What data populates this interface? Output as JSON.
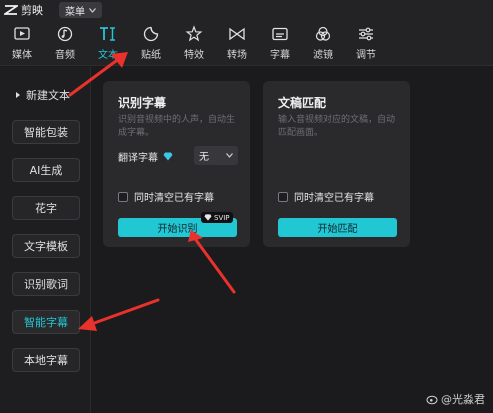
{
  "app": {
    "name": "剪映",
    "menu_label": "菜单"
  },
  "tools": [
    {
      "label": "媒体",
      "icon": "media-icon"
    },
    {
      "label": "音频",
      "icon": "audio-icon"
    },
    {
      "label": "文本",
      "icon": "text-icon",
      "active": true
    },
    {
      "label": "贴纸",
      "icon": "sticker-icon"
    },
    {
      "label": "特效",
      "icon": "effects-icon"
    },
    {
      "label": "转场",
      "icon": "transition-icon"
    },
    {
      "label": "字幕",
      "icon": "subtitle-icon"
    },
    {
      "label": "滤镜",
      "icon": "filter-icon"
    },
    {
      "label": "调节",
      "icon": "adjust-icon"
    }
  ],
  "sidebar": {
    "items": [
      {
        "label": "新建文本"
      },
      {
        "label": "智能包装"
      },
      {
        "label": "AI生成"
      },
      {
        "label": "花字"
      },
      {
        "label": "文字模板"
      },
      {
        "label": "识别歌词"
      },
      {
        "label": "智能字幕",
        "active": true
      },
      {
        "label": "本地字幕"
      }
    ]
  },
  "card_recognize": {
    "title": "识别字幕",
    "description": "识别音视频中的人声，自动生成字幕。",
    "translate_label": "翻译字幕",
    "translate_value": "无",
    "clear_label": "同时清空已有字幕",
    "button_label": "开始识别",
    "badge": "SVIP"
  },
  "card_match": {
    "title": "文稿匹配",
    "description": "输入音视频对应的文稿，自动匹配画面。",
    "clear_label": "同时清空已有字幕",
    "button_label": "开始匹配"
  },
  "watermark": "@光淼君",
  "colors": {
    "accent": "#22c7d4",
    "arrow": "#e8322b",
    "background": "#1b1b1d",
    "card": "#2a2a2d"
  }
}
